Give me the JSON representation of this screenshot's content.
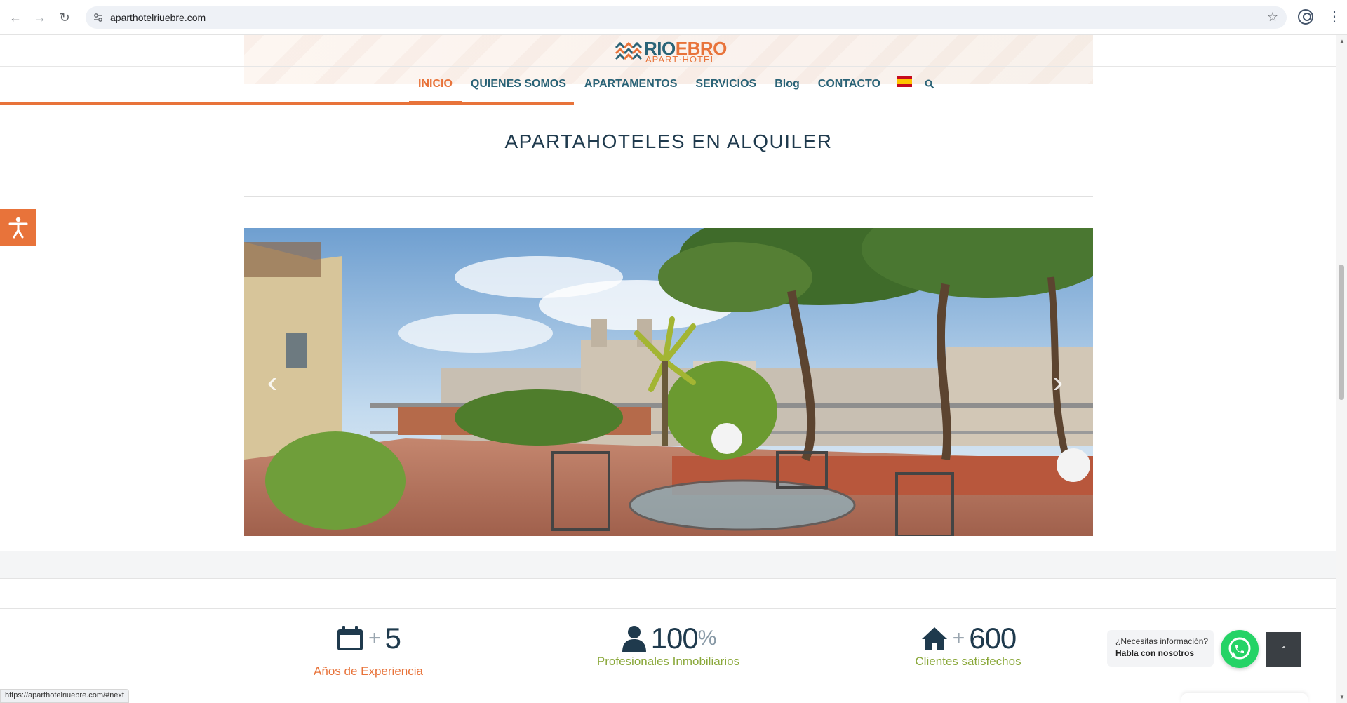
{
  "browser": {
    "url": "aparthotelriuebre.com",
    "status_url": "https://aparthotelriuebre.com/#next"
  },
  "logo": {
    "text_rio": "RIO",
    "text_ebro": "EBRO",
    "subtitle": "APART·HOTEL"
  },
  "nav": {
    "items": [
      {
        "label": "INICIO"
      },
      {
        "label": "QUIENES SOMOS"
      },
      {
        "label": "APARTAMENTOS"
      },
      {
        "label": "SERVICIOS"
      },
      {
        "label": "Blog"
      },
      {
        "label": "CONTACTO"
      }
    ]
  },
  "section": {
    "title": "APARTAHOTELES EN ALQUILER"
  },
  "slider": {
    "prev_glyph": "‹",
    "next_glyph": "›"
  },
  "stats": [
    {
      "plus": "+",
      "number": "5",
      "label": "Años de Experiencia"
    },
    {
      "number": "100",
      "suffix": "%",
      "label": "Profesionales Inmobiliarios"
    },
    {
      "plus": "+",
      "number": "600",
      "label": "Clientes satisfechos"
    }
  ],
  "whatsapp": {
    "question": "¿Necesitas información?",
    "cta": "Habla con nosotros"
  },
  "colors": {
    "accent": "#e8733a",
    "brand": "#2a6377",
    "green": "#8aa83a",
    "whatsapp": "#25d366"
  }
}
